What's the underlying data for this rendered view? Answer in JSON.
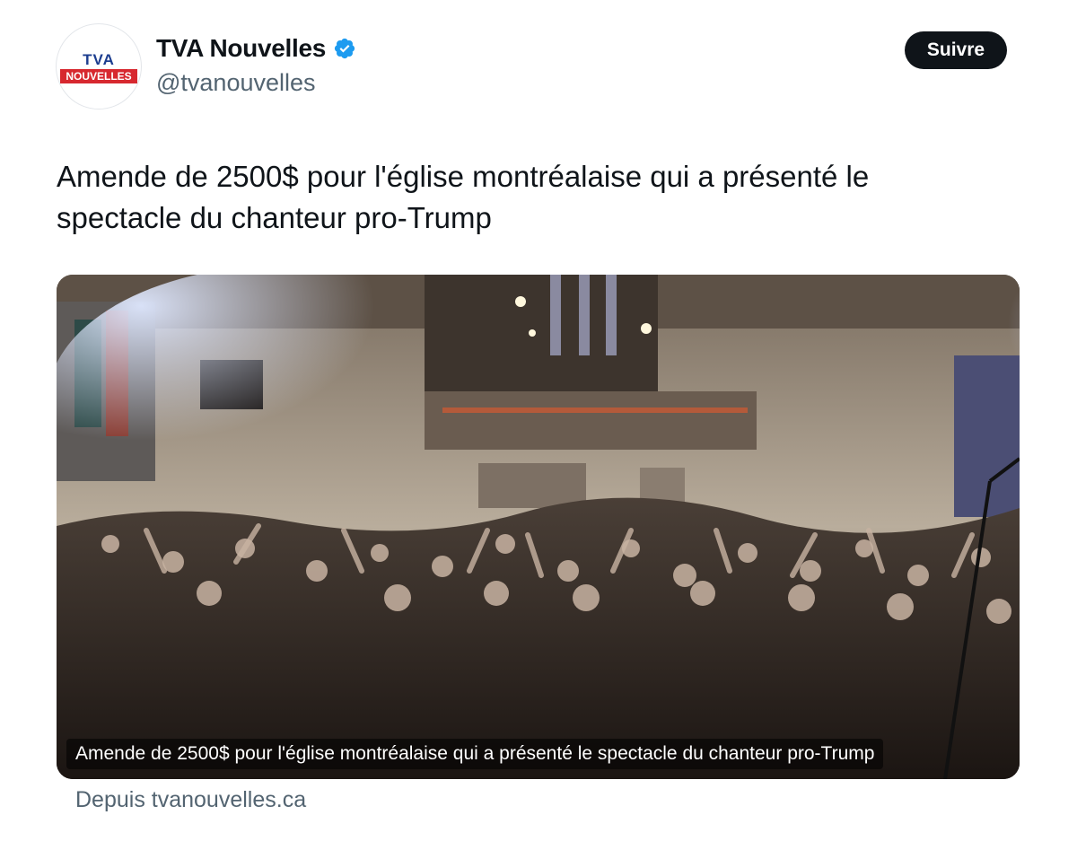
{
  "author": {
    "name": "TVA Nouvelles",
    "handle": "@tvanouvelles",
    "logo_top": "TVA",
    "logo_bottom": "NOUVELLES"
  },
  "follow_label": "Suivre",
  "tweet_text": "Amende de 2500$ pour l'église montréalaise qui a présenté le spectacle du chanteur pro-Trump",
  "card": {
    "caption": "Amende de 2500$ pour l'église montréalaise qui a présenté le spectacle du chanteur pro-Trump"
  },
  "source": "Depuis tvanouvelles.ca",
  "colors": {
    "follow_bg": "#0f1419",
    "verified": "#1d9bf0",
    "secondary_text": "#536471",
    "brand_red": "#d7282f",
    "brand_blue": "#1c3d8f"
  },
  "icons": {
    "verified": "verified-badge-icon"
  }
}
